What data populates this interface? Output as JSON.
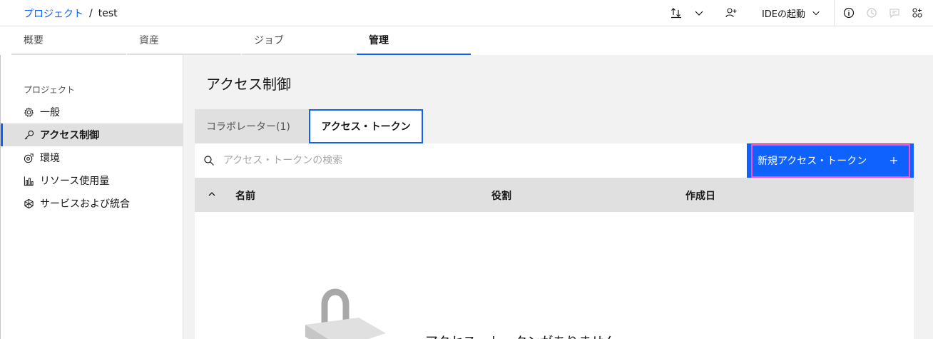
{
  "breadcrumb": {
    "root": "プロジェクト",
    "separator": "/",
    "current": "test"
  },
  "topbar": {
    "ide_label": "IDEの起動"
  },
  "tabs": [
    {
      "label": "概要"
    },
    {
      "label": "資産"
    },
    {
      "label": "ジョブ"
    },
    {
      "label": "管理"
    }
  ],
  "sidebar": {
    "heading": "プロジェクト",
    "items": [
      {
        "label": "一般",
        "icon": "gear-icon"
      },
      {
        "label": "アクセス制御",
        "icon": "key-icon"
      },
      {
        "label": "環境",
        "icon": "environment-icon"
      },
      {
        "label": "リソース使用量",
        "icon": "chart-bar-icon"
      },
      {
        "label": "サービスおよび統合",
        "icon": "integration-icon"
      }
    ]
  },
  "main": {
    "title": "アクセス制御",
    "subtabs": [
      {
        "label": "コラボレーター(1)"
      },
      {
        "label": "アクセス・トークン"
      }
    ],
    "search": {
      "placeholder": "アクセス・トークンの検索"
    },
    "new_button": {
      "label": "新規アクセス・トークン",
      "icon": "plus-icon"
    },
    "table": {
      "columns": [
        "名前",
        "役割",
        "作成日"
      ]
    },
    "empty_text": "アクセス・トークンがありません"
  },
  "colors": {
    "accent": "#0f62fe",
    "highlight": "#ff4dd2"
  }
}
